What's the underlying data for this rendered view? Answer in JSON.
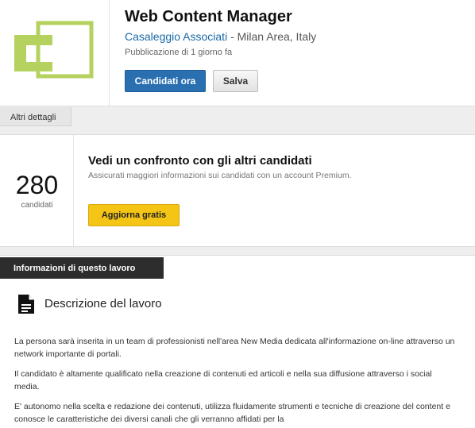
{
  "job": {
    "title": "Web Content Manager",
    "company": "Casaleggio Associati",
    "location": " - Milan Area, Italy",
    "posted": "Pubblicazione di 1 giorno fa",
    "apply_label": "Candidati ora",
    "save_label": "Salva",
    "logo_color": "#b5d25e"
  },
  "details_tab": "Altri dettagli",
  "compare": {
    "count": "280",
    "count_label": "candidati",
    "title": "Vedi un confronto con gli altri candidati",
    "subtitle": "Assicurati maggiori informazioni sui candidati con un account Premium.",
    "upgrade_label": "Aggiorna gratis"
  },
  "info": {
    "header": "Informazioni di questo lavoro",
    "desc_title": "Descrizione del lavoro",
    "paragraphs": [
      "La persona sarà inserita in un team di professionisti nell'area New Media dedicata all'informazione on-line attraverso un network importante di portali.",
      "Il candidato è altamente qualificato nella creazione di contenuti ed articoli e nella sua diffusione attraverso i social media.",
      "E' autonomo nella scelta e redazione dei contenuti, utilizza fluidamente strumenti e tecniche di creazione del content e conosce le caratteristiche dei diversi canali che gli verranno affidati per la"
    ]
  }
}
